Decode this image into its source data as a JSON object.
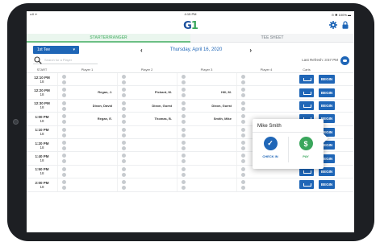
{
  "status_bar": {
    "left": "••ll ᯤ",
    "time": "4:15 PM",
    "right": "⊙ ✱ 100% ▬"
  },
  "header": {
    "logo_letter": "G",
    "logo_mark": "1"
  },
  "tabs": [
    {
      "label": "STARTER/RANGER",
      "active": true
    },
    {
      "label": "TEE SHEET",
      "active": false
    }
  ],
  "controls": {
    "tee_select": "1st Tee",
    "date": "Thursday, April 16, 2020",
    "prev": "‹",
    "next": "›"
  },
  "search": {
    "placeholder": "Search for a Player"
  },
  "refresh": "Last Refresh: 3:57 PM",
  "columns": {
    "start": "START",
    "player1": "Player 1",
    "player2": "Player 2",
    "player3": "Player 3",
    "player4": "Player 4",
    "carts": "Carts"
  },
  "rows": [
    {
      "time": "12:10 PM",
      "holes": "18",
      "p1": "",
      "p2": "",
      "p3": "",
      "p4": ""
    },
    {
      "time": "12:20 PM",
      "holes": "18",
      "p1": "Regan, J.",
      "p2": "Pickard, M.",
      "p3": "Hill, M.",
      "p4": ""
    },
    {
      "time": "12:30 PM",
      "holes": "18",
      "p1": "Dixon, David",
      "p2": "Dixon, Guest",
      "p3": "Dixon, Guest",
      "p4": ""
    },
    {
      "time": "1:00 PM",
      "holes": "18",
      "p1": "Regan, E.",
      "p2": "Thomas, B.",
      "p3": "Smith, Mike",
      "p4": ""
    },
    {
      "time": "1:10 PM",
      "holes": "18",
      "p1": "",
      "p2": "",
      "p3": "",
      "p4": ""
    },
    {
      "time": "1:20 PM",
      "holes": "18",
      "p1": "",
      "p2": "",
      "p3": "",
      "p4": ""
    },
    {
      "time": "1:40 PM",
      "holes": "18",
      "p1": "",
      "p2": "",
      "p3": "",
      "p4": ""
    },
    {
      "time": "1:50 PM",
      "holes": "18",
      "p1": "",
      "p2": "",
      "p3": "",
      "p4": ""
    },
    {
      "time": "2:00 PM",
      "holes": "18",
      "p1": "",
      "p2": "",
      "p3": "",
      "p4": ""
    }
  ],
  "begin_label": "BEGIN",
  "popup": {
    "name": "Mike Smith",
    "checkin": "CHECK IN",
    "pay": "PAY",
    "checkin_glyph": "✓",
    "pay_glyph": "$"
  },
  "colors": {
    "primary": "#1f66b7",
    "accent": "#3aa65c",
    "bezel": "#1d1f23"
  }
}
